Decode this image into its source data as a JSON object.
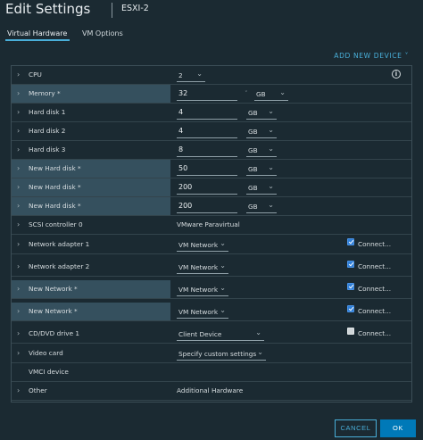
{
  "header": {
    "title": "Edit Settings",
    "vm_name": "ESXI-2"
  },
  "tabs": [
    {
      "label": "Virtual Hardware",
      "active": true
    },
    {
      "label": "VM Options",
      "active": false
    }
  ],
  "add_device_label": "ADD NEW DEVICE ˅",
  "info_icon": "i",
  "rows": [
    {
      "label": "CPU",
      "value": "2",
      "expandable": true
    },
    {
      "label": "Memory *",
      "value": "32",
      "unit_dim": "˅",
      "unit": "GB",
      "expandable": true,
      "highlight": true
    },
    {
      "label": "Hard disk 1",
      "value": "4",
      "unit": "GB",
      "expandable": true
    },
    {
      "label": "Hard disk 2",
      "value": "4",
      "unit": "GB",
      "expandable": true
    },
    {
      "label": "Hard disk 3",
      "value": "8",
      "unit": "GB",
      "expandable": true
    },
    {
      "label": "New Hard disk *",
      "value": "50",
      "unit": "GB",
      "expandable": true,
      "highlight": true
    },
    {
      "label": "New Hard disk *",
      "value": "200",
      "unit": "GB",
      "expandable": true,
      "highlight": true
    },
    {
      "label": "New Hard disk *",
      "value": "200",
      "unit": "GB",
      "expandable": true,
      "highlight": true
    },
    {
      "label": "SCSI controller 0",
      "value": "VMware Paravirtual",
      "expandable": true
    },
    {
      "label": "Network adapter 1",
      "value": "VM Network",
      "connect": "Connect...",
      "connected": true,
      "expandable": true
    },
    {
      "label": "Network adapter 2",
      "value": "VM Network",
      "connect": "Connect...",
      "connected": true,
      "expandable": true
    },
    {
      "label": "New Network *",
      "value": "VM Network",
      "connect": "Connect...",
      "connected": true,
      "expandable": true,
      "highlight": true
    },
    {
      "label": "New Network *",
      "value": "VM Network",
      "connect": "Connect...",
      "connected": true,
      "expandable": true,
      "highlight": true
    },
    {
      "label": "CD/DVD drive 1",
      "value": "Client Device",
      "connect": "Connect...",
      "connected": false,
      "expandable": true
    },
    {
      "label": "Video card",
      "value": "Specify custom settings",
      "expandable": true
    },
    {
      "label": "VMCI device",
      "value": "",
      "expandable": false
    },
    {
      "label": "Other",
      "value": "Additional Hardware",
      "expandable": true
    }
  ],
  "chevron_glyph": "›",
  "caret_glyph": "⌄",
  "footer": {
    "cancel_label": "CANCEL",
    "ok_label": "OK"
  },
  "colors": {
    "accent": "#49afd9",
    "primary": "#0079b8",
    "background": "#1b2a32",
    "highlight": "#35505e"
  }
}
